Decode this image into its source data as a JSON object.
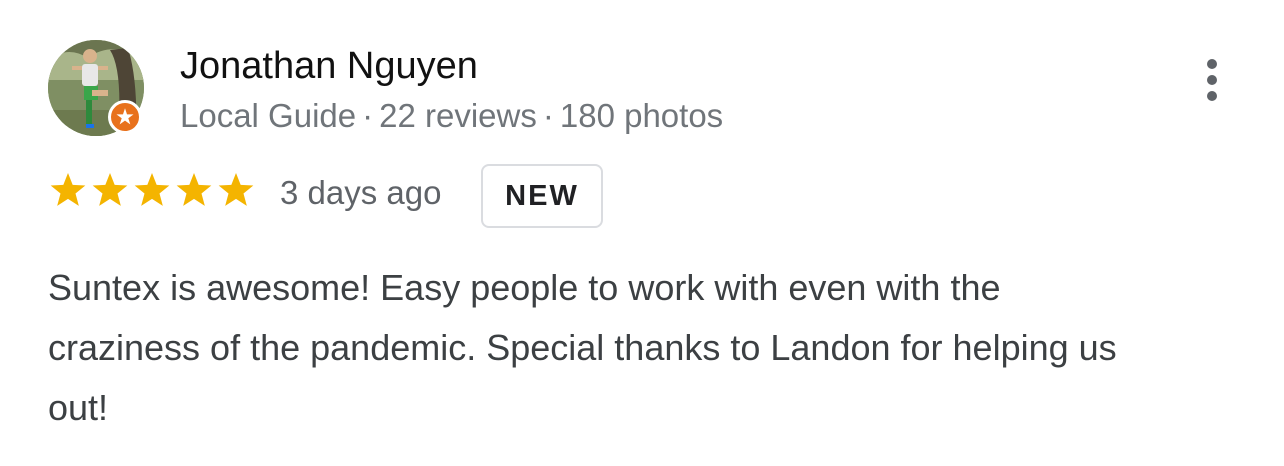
{
  "review": {
    "reviewer": {
      "name": "Jonathan Nguyen",
      "level": "Local Guide",
      "reviews": "22 reviews",
      "photos": "180 photos",
      "avatar_icon": "profile-photo",
      "badge_icon": "local-guide-star-icon",
      "badge_color": "#e8711c"
    },
    "menu_icon": "more-vert-icon",
    "rating": 5,
    "rating_max": 5,
    "star_color": "#f4b400",
    "date": "3 days ago",
    "badge": "NEW",
    "text": "Suntex is awesome! Easy people to work with even with the craziness of the pandemic. Special thanks to Landon for helping us out!"
  }
}
